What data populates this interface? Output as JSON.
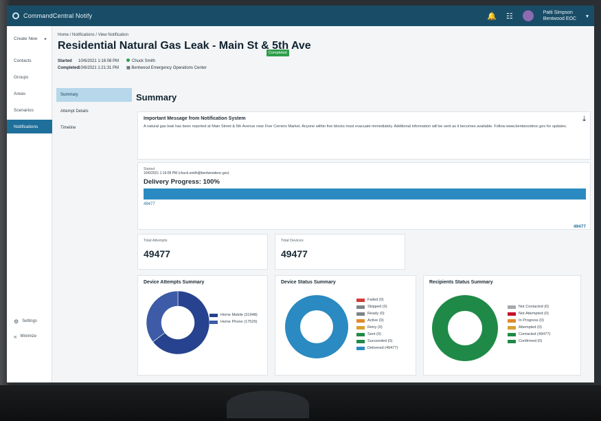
{
  "app": {
    "title": "CommandCentral Notify"
  },
  "user": {
    "name": "Patti Simpson",
    "org": "Bentwood EOC"
  },
  "sidebar": {
    "items": [
      {
        "label": "Create New",
        "has_arrow": true
      },
      {
        "label": "Contacts"
      },
      {
        "label": "Groups"
      },
      {
        "label": "Areas"
      },
      {
        "label": "Scenarios"
      },
      {
        "label": "Notifications",
        "active": true
      }
    ],
    "bottom": [
      {
        "label": "Settings",
        "icon": "gear-icon"
      },
      {
        "label": "Minimize",
        "icon": "chevron-double-left-icon"
      }
    ]
  },
  "page": {
    "breadcrumb": "Home / Notifications / View Notification",
    "title": "Residential Natural Gas Leak - Main St & 5th Ave",
    "status": "Completed",
    "started_label": "Started",
    "started_value": "10/6/2021 1:16:08 PM",
    "completed_label": "Completed",
    "completed_value": "10/6/2021 1:21:31 PM",
    "sender": "Chuck Smith",
    "sender_org": "Bentwood Emergency Operations Center"
  },
  "tabs": [
    "Summary",
    "Attempt Details",
    "Timeline"
  ],
  "summary": {
    "heading": "Summary",
    "message_title": "Important Message from Notification System",
    "message_body": "A natural gas leak has been reported at Main Street & 5th Avenue near Five Corners Market. Anyone within five blocks must evacuate immediately. Additional information will be sent as it becomes available. Follow www.bentwoodeoc.gov for updates.",
    "started_label": "Started",
    "started_value": "10/6/2021 1:16:09 PM (chuck.smith@bentwoodeoc.gov)",
    "progress_title": "Delivery Progress: 100%",
    "progress_value": 100,
    "progress_left_label": "49477",
    "progress_right_label": "49477",
    "total_attempts_label": "Total Attempts",
    "total_attempts": "49477",
    "total_devices_label": "Total Devices",
    "total_devices": "49477"
  },
  "charts": {
    "device_attempts": {
      "title": "Device Attempts Summary",
      "legend": [
        "Home Mobile (31948)",
        "Home Phone (17529)"
      ],
      "colors": [
        "#27438f",
        "#3d5ba6"
      ]
    },
    "device_status": {
      "title": "Device Status Summary",
      "legend": [
        "Failed (0)",
        "Skipped (0)",
        "Ready (0)",
        "Active (0)",
        "Retry (0)",
        "Sent (0)",
        "Succeeded (0)",
        "Delivered (49477)"
      ],
      "colors": [
        "#d23b3b",
        "#7c8488",
        "#7c8488",
        "#e08a2b",
        "#d9a030",
        "#1f8a47",
        "#1f8a47",
        "#2b8ac1"
      ]
    },
    "recipients_status": {
      "title": "Recipients Status Summary",
      "legend": [
        "Not Contacted (0)",
        "Not Attempted (0)",
        "In Progress (0)",
        "Attempted (0)",
        "Contacted (49477)",
        "Confirmed (0)"
      ],
      "colors": [
        "#a3a9ad",
        "#c8102e",
        "#e08a2b",
        "#d9a030",
        "#1f8a47",
        "#1f8a47"
      ]
    }
  },
  "chart_data": [
    {
      "type": "pie",
      "title": "Device Attempts Summary",
      "categories": [
        "Home Mobile",
        "Home Phone"
      ],
      "values": [
        31948,
        17529
      ]
    },
    {
      "type": "pie",
      "title": "Device Status Summary",
      "categories": [
        "Failed",
        "Skipped",
        "Ready",
        "Active",
        "Retry",
        "Sent",
        "Succeeded",
        "Delivered"
      ],
      "values": [
        0,
        0,
        0,
        0,
        0,
        0,
        0,
        49477
      ]
    },
    {
      "type": "pie",
      "title": "Recipients Status Summary",
      "categories": [
        "Not Contacted",
        "Not Attempted",
        "In Progress",
        "Attempted",
        "Contacted",
        "Confirmed"
      ],
      "values": [
        0,
        0,
        0,
        0,
        49477,
        0
      ]
    }
  ]
}
